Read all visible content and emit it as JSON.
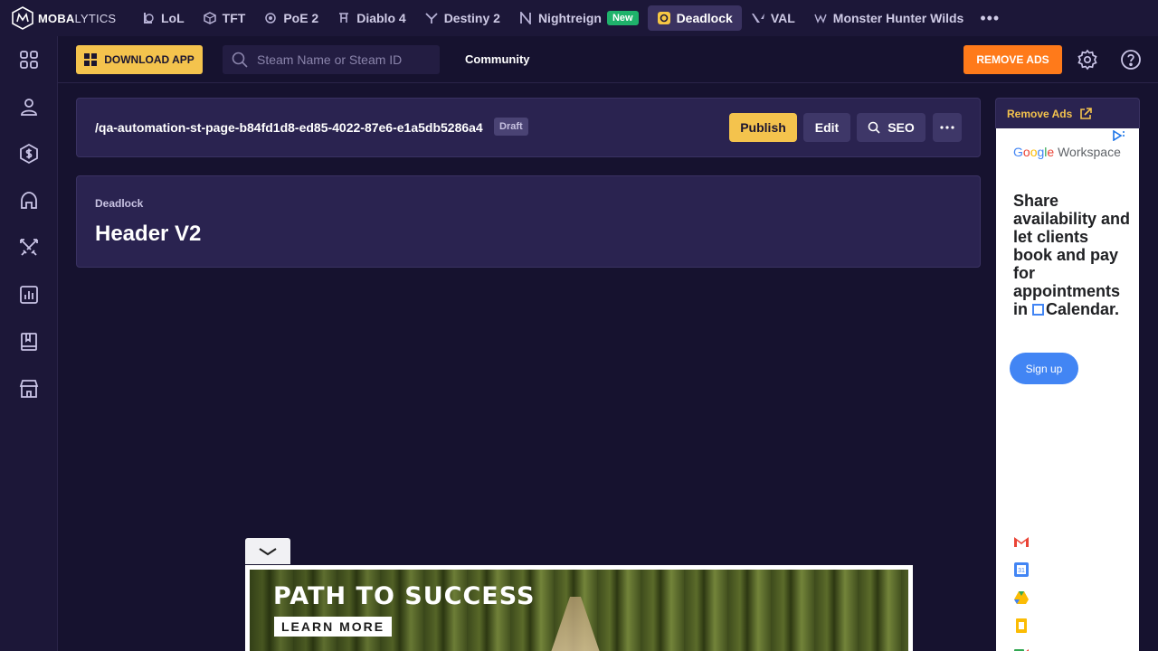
{
  "brand": {
    "logo_bold": "MOBA",
    "logo_light": "LYTICS"
  },
  "games": [
    {
      "label": "LoL",
      "icon": "lol-icon"
    },
    {
      "label": "TFT",
      "icon": "tft-icon"
    },
    {
      "label": "PoE 2",
      "icon": "poe-icon"
    },
    {
      "label": "Diablo 4",
      "icon": "diablo-icon"
    },
    {
      "label": "Destiny 2",
      "icon": "destiny-icon"
    },
    {
      "label": "Nightreign",
      "icon": "nightreign-icon",
      "badge": "New"
    },
    {
      "label": "Deadlock",
      "icon": "deadlock-icon",
      "active": true
    },
    {
      "label": "VAL",
      "icon": "valorant-icon"
    },
    {
      "label": "Monster Hunter Wilds",
      "icon": "mhw-icon"
    }
  ],
  "subbar": {
    "download_label": "DOWNLOAD APP",
    "search_placeholder": "Steam Name or Steam ID",
    "community_label": "Community",
    "remove_ads_label": "REMOVE ADS"
  },
  "page": {
    "path": "/qa-automation-st-page-b84fd1d8-ed85-4022-87e6-e1a5db5286a4",
    "status": "Draft",
    "publish_label": "Publish",
    "edit_label": "Edit",
    "seo_label": "SEO",
    "breadcrumb": "Deadlock",
    "title": "Header V2"
  },
  "side_ad": {
    "remove_ads_link": "Remove Ads",
    "brand_g": "G",
    "brand_o1": "o",
    "brand_o2": "o",
    "brand_g2": "g",
    "brand_l": "l",
    "brand_e": "e",
    "brand_rest": " Workspace",
    "headline_before": "Share availability and let clients book and pay for appointments in ",
    "headline_after": "Calendar.",
    "cta": "Sign up"
  },
  "banner": {
    "title": "PATH TO SUCCESS",
    "cta": "LEARN MORE"
  },
  "colors": {
    "accent_yellow": "#f4c34d",
    "accent_orange": "#ff7a1a",
    "bg": "#16122f",
    "card": "#2a2350"
  }
}
